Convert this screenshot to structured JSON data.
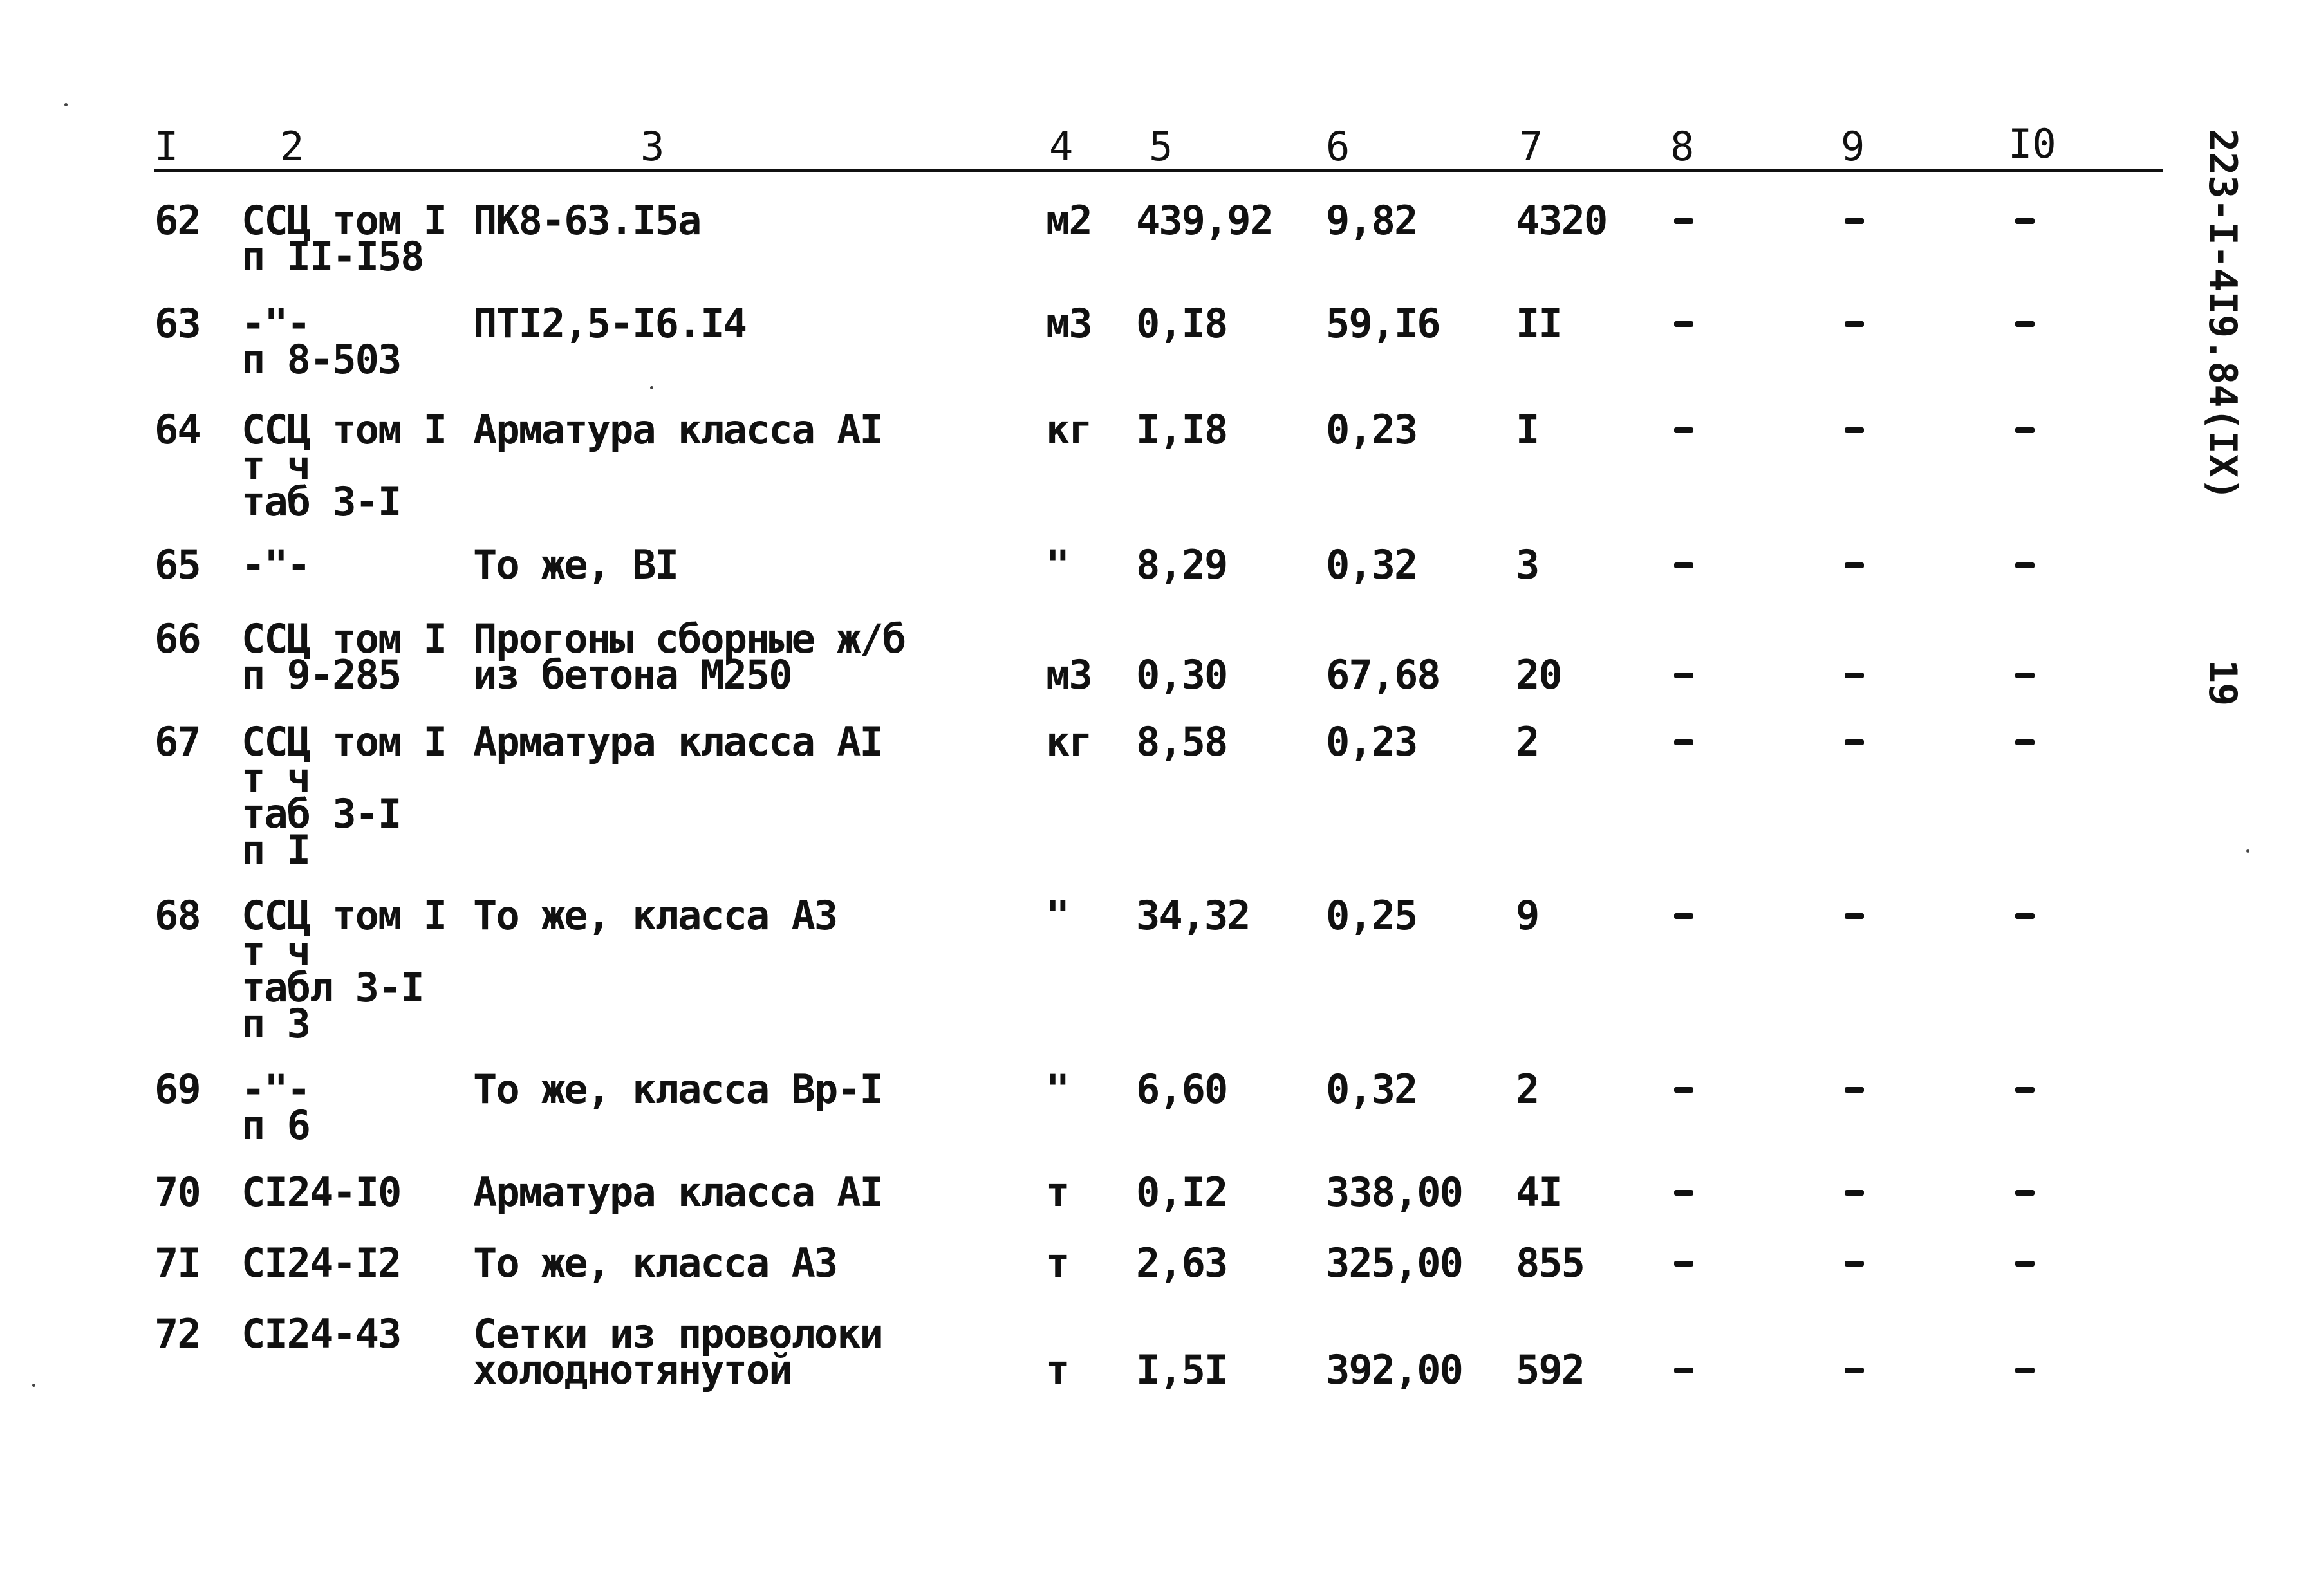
{
  "document": {
    "side_code": "223-I-4I9.84(IX)",
    "page_number": "19"
  },
  "table": {
    "headers": [
      "I",
      "2",
      "3",
      "4",
      "5",
      "6",
      "7",
      "8",
      "9",
      "I0"
    ],
    "rows": [
      {
        "n": "62",
        "ref": [
          "ССЦ том I",
          "п II-I58"
        ],
        "name": [
          "ПК8-63.I5а"
        ],
        "unit": "м2",
        "qty": "439,92",
        "price": "9,82",
        "total": "4320",
        "c8": "-",
        "c9": "-",
        "c10": "-"
      },
      {
        "n": "63",
        "ref": [
          "-\"-",
          "п 8-503"
        ],
        "name": [
          "ПТI2,5-I6.I4"
        ],
        "unit": "м3",
        "qty": "0,I8",
        "price": "59,I6",
        "total": "II",
        "c8": "-",
        "c9": "-",
        "c10": "-"
      },
      {
        "n": "64",
        "ref": [
          "ССЦ том I",
          "т ч",
          "таб 3-I"
        ],
        "name": [
          "Арматура класса АI"
        ],
        "unit": "кг",
        "qty": "I,I8",
        "price": "0,23",
        "total": "I",
        "c8": "-",
        "c9": "-",
        "c10": "-"
      },
      {
        "n": "65",
        "ref": [
          "-\"-"
        ],
        "name": [
          "То же, ВI"
        ],
        "unit": "\"",
        "qty": "8,29",
        "price": "0,32",
        "total": "3",
        "c8": "-",
        "c9": "-",
        "c10": "-"
      },
      {
        "n": "66",
        "ref": [
          "ССЦ том I",
          "п 9-285"
        ],
        "name": [
          "Прогоны сборные ж/б",
          "из бетона М250"
        ],
        "unit": "м3",
        "qty": "0,30",
        "price": "67,68",
        "total": "20",
        "c8": "-",
        "c9": "-",
        "c10": "-"
      },
      {
        "n": "67",
        "ref": [
          "ССЦ том I",
          "т ч",
          "таб 3-I",
          "п I"
        ],
        "name": [
          "Арматура класса АI"
        ],
        "unit": "кг",
        "qty": "8,58",
        "price": "0,23",
        "total": "2",
        "c8": "-",
        "c9": "-",
        "c10": "-"
      },
      {
        "n": "68",
        "ref": [
          "ССЦ том I",
          "т ч",
          "табл 3-I",
          "п 3"
        ],
        "name": [
          "То же, класса А3"
        ],
        "unit": "\"",
        "qty": "34,32",
        "price": "0,25",
        "total": "9",
        "c8": "-",
        "c9": "-",
        "c10": "-"
      },
      {
        "n": "69",
        "ref": [
          "-\"-",
          "п 6"
        ],
        "name": [
          "То же, класса Вр-I"
        ],
        "unit": "\"",
        "qty": "6,60",
        "price": "0,32",
        "total": "2",
        "c8": "-",
        "c9": "-",
        "c10": "-"
      },
      {
        "n": "70",
        "ref": [
          "СI24-I0"
        ],
        "name": [
          "Арматура класса АI"
        ],
        "unit": "т",
        "qty": "0,I2",
        "price": "338,00",
        "total": "4I",
        "c8": "-",
        "c9": "-",
        "c10": "-"
      },
      {
        "n": "7I",
        "ref": [
          "СI24-I2"
        ],
        "name": [
          "То же, класса А3"
        ],
        "unit": "т",
        "qty": "2,63",
        "price": "325,00",
        "total": "855",
        "c8": "-",
        "c9": "-",
        "c10": "-"
      },
      {
        "n": "72",
        "ref": [
          "СI24-43"
        ],
        "name": [
          "Сетки из проволоки",
          "холоднотянутой"
        ],
        "unit": "т",
        "qty": "I,5I",
        "price": "392,00",
        "total": "592",
        "c8": "-",
        "c9": "-",
        "c10": "-"
      }
    ]
  }
}
